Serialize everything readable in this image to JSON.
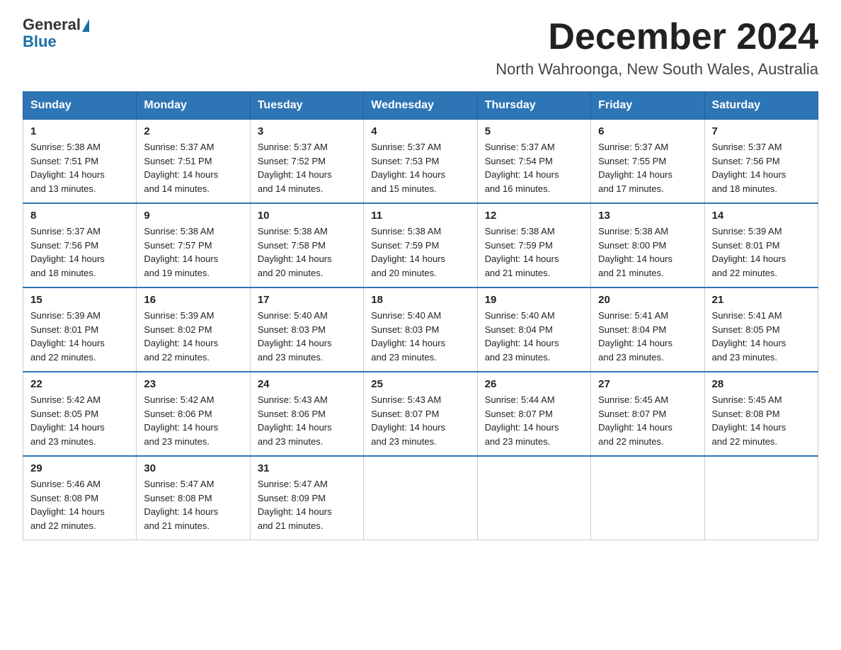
{
  "header": {
    "logo_general": "General",
    "logo_blue": "Blue",
    "title": "December 2024",
    "subtitle": "North Wahroonga, New South Wales, Australia"
  },
  "weekdays": [
    "Sunday",
    "Monday",
    "Tuesday",
    "Wednesday",
    "Thursday",
    "Friday",
    "Saturday"
  ],
  "weeks": [
    [
      {
        "day": "1",
        "sunrise": "5:38 AM",
        "sunset": "7:51 PM",
        "daylight": "14 hours and 13 minutes."
      },
      {
        "day": "2",
        "sunrise": "5:37 AM",
        "sunset": "7:51 PM",
        "daylight": "14 hours and 14 minutes."
      },
      {
        "day": "3",
        "sunrise": "5:37 AM",
        "sunset": "7:52 PM",
        "daylight": "14 hours and 14 minutes."
      },
      {
        "day": "4",
        "sunrise": "5:37 AM",
        "sunset": "7:53 PM",
        "daylight": "14 hours and 15 minutes."
      },
      {
        "day": "5",
        "sunrise": "5:37 AM",
        "sunset": "7:54 PM",
        "daylight": "14 hours and 16 minutes."
      },
      {
        "day": "6",
        "sunrise": "5:37 AM",
        "sunset": "7:55 PM",
        "daylight": "14 hours and 17 minutes."
      },
      {
        "day": "7",
        "sunrise": "5:37 AM",
        "sunset": "7:56 PM",
        "daylight": "14 hours and 18 minutes."
      }
    ],
    [
      {
        "day": "8",
        "sunrise": "5:37 AM",
        "sunset": "7:56 PM",
        "daylight": "14 hours and 18 minutes."
      },
      {
        "day": "9",
        "sunrise": "5:38 AM",
        "sunset": "7:57 PM",
        "daylight": "14 hours and 19 minutes."
      },
      {
        "day": "10",
        "sunrise": "5:38 AM",
        "sunset": "7:58 PM",
        "daylight": "14 hours and 20 minutes."
      },
      {
        "day": "11",
        "sunrise": "5:38 AM",
        "sunset": "7:59 PM",
        "daylight": "14 hours and 20 minutes."
      },
      {
        "day": "12",
        "sunrise": "5:38 AM",
        "sunset": "7:59 PM",
        "daylight": "14 hours and 21 minutes."
      },
      {
        "day": "13",
        "sunrise": "5:38 AM",
        "sunset": "8:00 PM",
        "daylight": "14 hours and 21 minutes."
      },
      {
        "day": "14",
        "sunrise": "5:39 AM",
        "sunset": "8:01 PM",
        "daylight": "14 hours and 22 minutes."
      }
    ],
    [
      {
        "day": "15",
        "sunrise": "5:39 AM",
        "sunset": "8:01 PM",
        "daylight": "14 hours and 22 minutes."
      },
      {
        "day": "16",
        "sunrise": "5:39 AM",
        "sunset": "8:02 PM",
        "daylight": "14 hours and 22 minutes."
      },
      {
        "day": "17",
        "sunrise": "5:40 AM",
        "sunset": "8:03 PM",
        "daylight": "14 hours and 23 minutes."
      },
      {
        "day": "18",
        "sunrise": "5:40 AM",
        "sunset": "8:03 PM",
        "daylight": "14 hours and 23 minutes."
      },
      {
        "day": "19",
        "sunrise": "5:40 AM",
        "sunset": "8:04 PM",
        "daylight": "14 hours and 23 minutes."
      },
      {
        "day": "20",
        "sunrise": "5:41 AM",
        "sunset": "8:04 PM",
        "daylight": "14 hours and 23 minutes."
      },
      {
        "day": "21",
        "sunrise": "5:41 AM",
        "sunset": "8:05 PM",
        "daylight": "14 hours and 23 minutes."
      }
    ],
    [
      {
        "day": "22",
        "sunrise": "5:42 AM",
        "sunset": "8:05 PM",
        "daylight": "14 hours and 23 minutes."
      },
      {
        "day": "23",
        "sunrise": "5:42 AM",
        "sunset": "8:06 PM",
        "daylight": "14 hours and 23 minutes."
      },
      {
        "day": "24",
        "sunrise": "5:43 AM",
        "sunset": "8:06 PM",
        "daylight": "14 hours and 23 minutes."
      },
      {
        "day": "25",
        "sunrise": "5:43 AM",
        "sunset": "8:07 PM",
        "daylight": "14 hours and 23 minutes."
      },
      {
        "day": "26",
        "sunrise": "5:44 AM",
        "sunset": "8:07 PM",
        "daylight": "14 hours and 23 minutes."
      },
      {
        "day": "27",
        "sunrise": "5:45 AM",
        "sunset": "8:07 PM",
        "daylight": "14 hours and 22 minutes."
      },
      {
        "day": "28",
        "sunrise": "5:45 AM",
        "sunset": "8:08 PM",
        "daylight": "14 hours and 22 minutes."
      }
    ],
    [
      {
        "day": "29",
        "sunrise": "5:46 AM",
        "sunset": "8:08 PM",
        "daylight": "14 hours and 22 minutes."
      },
      {
        "day": "30",
        "sunrise": "5:47 AM",
        "sunset": "8:08 PM",
        "daylight": "14 hours and 21 minutes."
      },
      {
        "day": "31",
        "sunrise": "5:47 AM",
        "sunset": "8:09 PM",
        "daylight": "14 hours and 21 minutes."
      },
      null,
      null,
      null,
      null
    ]
  ],
  "labels": {
    "sunrise": "Sunrise:",
    "sunset": "Sunset:",
    "daylight": "Daylight:"
  }
}
